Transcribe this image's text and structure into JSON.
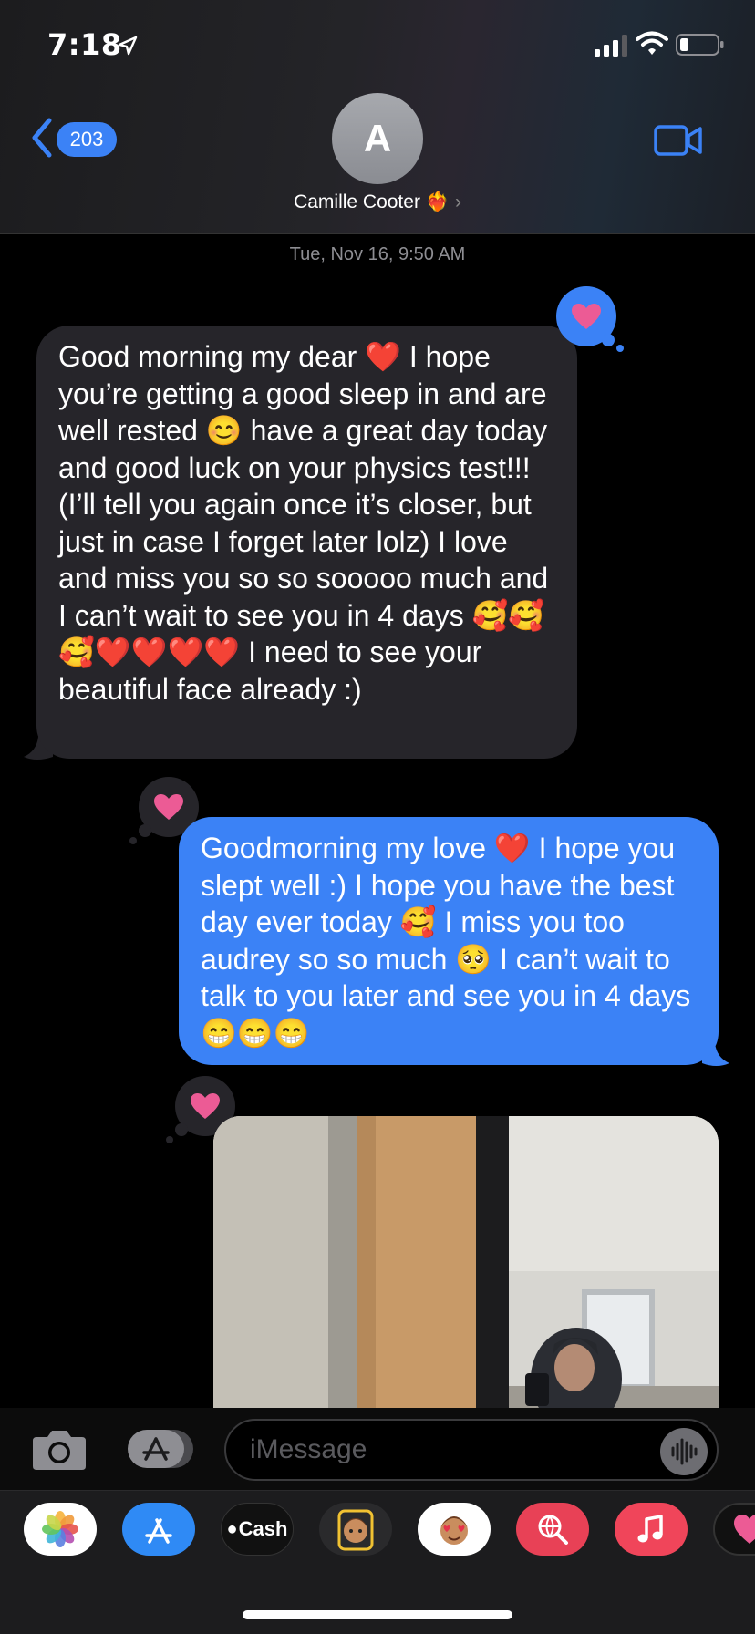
{
  "status_bar": {
    "time": "7:18"
  },
  "header": {
    "back_count": "203",
    "avatar_initial": "A",
    "contact_name": "Camille Cooter ❤️‍🔥",
    "chevron": "›"
  },
  "timestamp": "Tue, Nov 16, 9:50 AM",
  "messages": [
    {
      "direction": "incoming",
      "text": "Good morning my dear ❤️ I hope you’re getting a good sleep in and are well rested 😊 have a great day today and good luck on your physics test!!! (I’ll tell you again once it’s closer, but just in case I forget later lolz) I love and miss you so so sooooo much and I can’t wait to see you in 4 days 🥰🥰🥰❤️❤️❤️❤️ I need to see your beautiful face already :)",
      "tapback": "heart-icon"
    },
    {
      "direction": "outgoing",
      "text": "Goodmorning my love ❤️ I hope you slept well :) I hope you have the best day ever today 🥰 I miss you too audrey so so much 🥺 I can’t wait to talk to you later and see you in 4 days 😁😁😁",
      "tapback": "heart-icon"
    }
  ],
  "input": {
    "placeholder": "iMessage"
  },
  "drawer": {
    "cash_label": "Cash"
  },
  "colors": {
    "imessage_blue": "#3b82f6",
    "incoming_gray": "#26252a",
    "heart_pink": "#ec5b95"
  }
}
